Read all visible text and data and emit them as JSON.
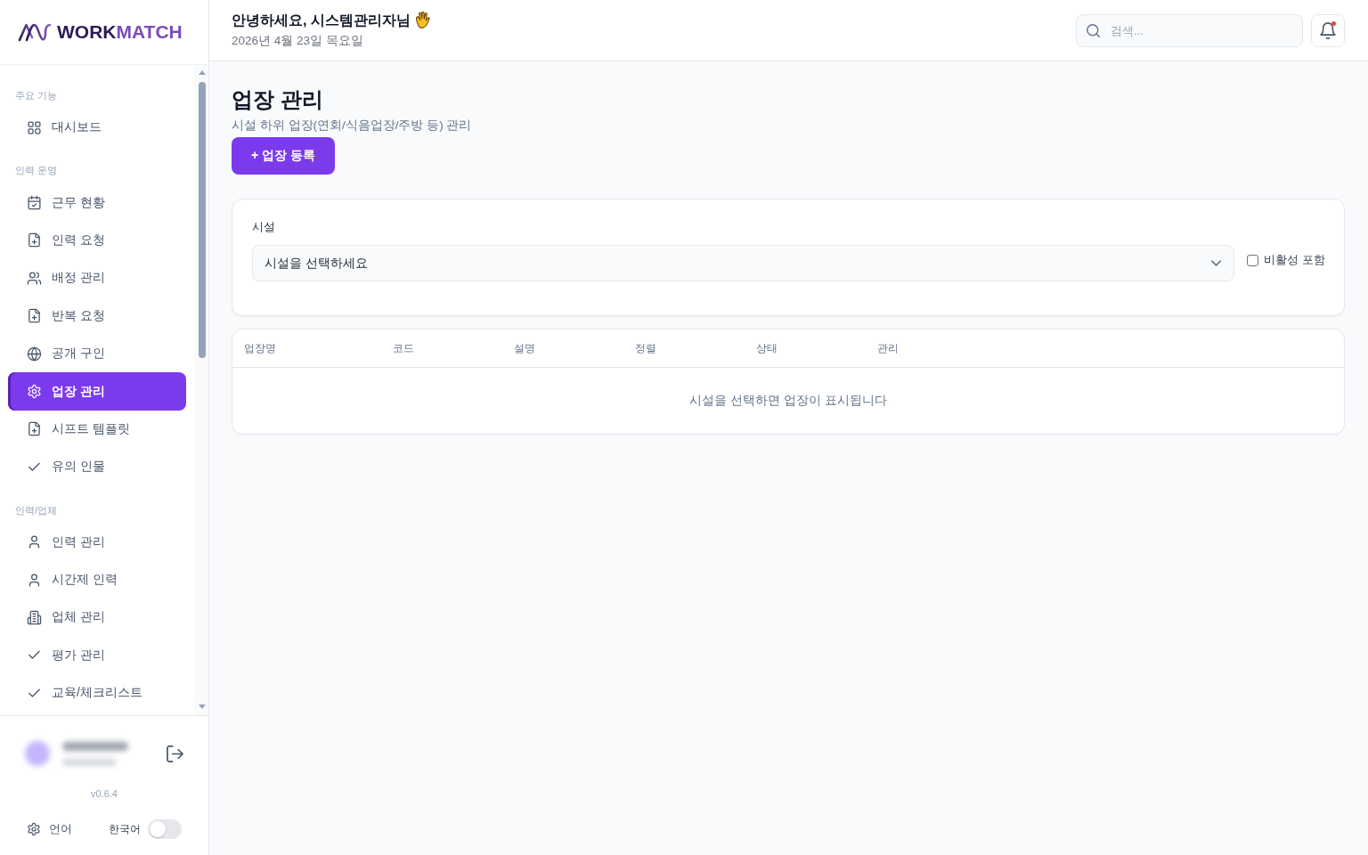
{
  "sidebar": {
    "logo": {
      "word_dark": "WORK",
      "word_accent": "MATCH"
    },
    "sections": [
      {
        "title": "주요 기능",
        "items": [
          {
            "label": "대시보드",
            "kind": "grid",
            "selected": false
          }
        ]
      },
      {
        "title": "인력 운영",
        "items": [
          {
            "label": "근무 현황",
            "kind": "calendar-check",
            "selected": false
          },
          {
            "label": "인력 요청",
            "kind": "file-plus",
            "selected": false
          },
          {
            "label": "배정 관리",
            "kind": "users",
            "selected": false
          },
          {
            "label": "반복 요청",
            "kind": "file-plus",
            "selected": false
          },
          {
            "label": "공개 구인",
            "kind": "globe",
            "selected": false
          },
          {
            "label": "업장 관리",
            "kind": "settings",
            "selected": true
          },
          {
            "label": "시프트 템플릿",
            "kind": "file-plus",
            "selected": false
          },
          {
            "label": "유의 인물",
            "kind": "check",
            "selected": false
          }
        ]
      },
      {
        "title": "인력/업체",
        "items": [
          {
            "label": "인력 관리",
            "kind": "user",
            "selected": false
          },
          {
            "label": "시간제 인력",
            "kind": "user",
            "selected": false
          },
          {
            "label": "업체 관리",
            "kind": "building",
            "selected": false
          },
          {
            "label": "평가 관리",
            "kind": "check",
            "selected": false
          },
          {
            "label": "교육/체크리스트",
            "kind": "check",
            "selected": false
          }
        ]
      }
    ],
    "version": "v0.6.4",
    "language": {
      "label": "언어",
      "value": "한국어",
      "on": false
    }
  },
  "header": {
    "greeting": "안녕하세요, 시스템관리자님",
    "date": "2026년 4월 23일 목요일",
    "search": {
      "placeholder": "검색..."
    },
    "notifications": {
      "unread": true
    }
  },
  "page": {
    "title": "업장 관리",
    "subtitle": "시설 하위 업장(연회/식음업장/주방 등) 관리",
    "add_button": "+ 업장 등록"
  },
  "filter": {
    "label": "시설",
    "select": {
      "placeholder": "시설을 선택하세요"
    },
    "include_inactive": {
      "label": "비활성 포함",
      "checked": false
    }
  },
  "table": {
    "columns": [
      "업장명",
      "코드",
      "설명",
      "정렬",
      "상태",
      "관리"
    ],
    "empty_message": "시설을 선택하면 업장이 표시됩니다"
  }
}
